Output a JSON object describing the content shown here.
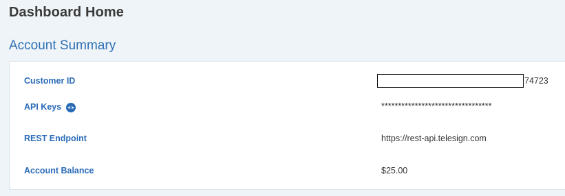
{
  "header": {
    "title": "Dashboard Home"
  },
  "account_summary": {
    "title": "Account Summary",
    "rows": {
      "customer_id": {
        "label": "Customer ID",
        "value_suffix": "74723"
      },
      "api_keys": {
        "label": "API Keys",
        "value": "*********************************",
        "icon": "eye-icon"
      },
      "rest_endpoint": {
        "label": "REST Endpoint",
        "value": "https://rest-api.telesign.com"
      },
      "account_balance": {
        "label": "Account Balance",
        "value": "$25.00"
      }
    }
  },
  "colors": {
    "background": "#eef4f7",
    "accent_blue": "#2a6bb8",
    "title_gray": "#3a3a3a"
  }
}
